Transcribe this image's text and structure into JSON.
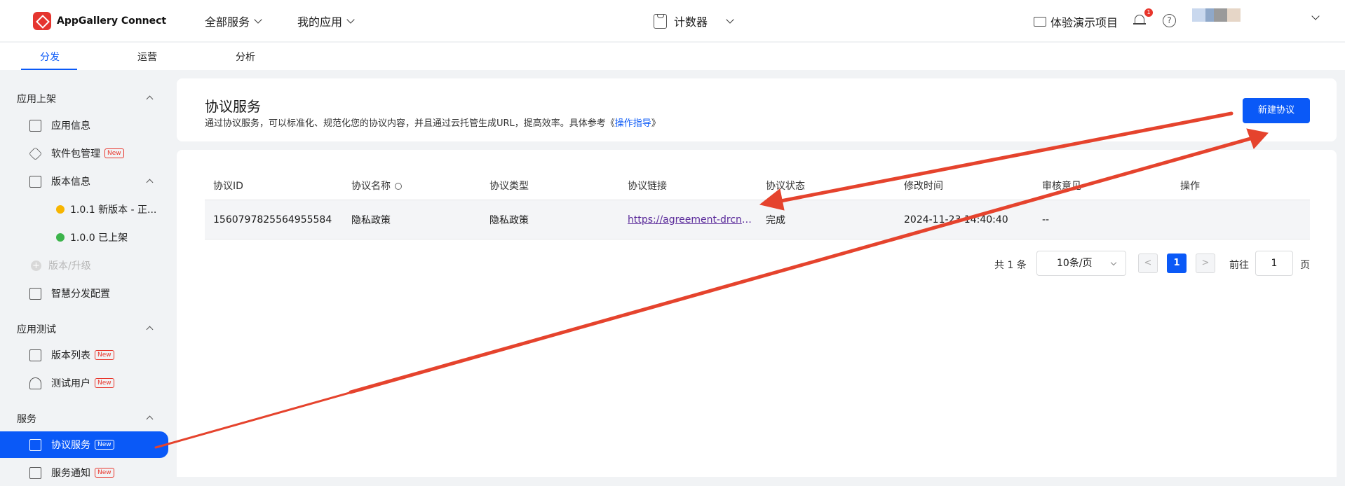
{
  "header": {
    "logo_text": "AppGallery Connect",
    "all_services": "全部服务",
    "my_apps": "我的应用",
    "current_app": "计数器",
    "demo_project": "体验演示项目",
    "notification_count": "1",
    "help": "?"
  },
  "tabs": [
    "分发",
    "运营",
    "分析"
  ],
  "sidebar": {
    "groups": [
      {
        "title": "应用上架"
      },
      {
        "title": "应用测试"
      },
      {
        "title": "服务"
      }
    ],
    "items": {
      "app_info": "应用信息",
      "package_mgmt": "软件包管理",
      "version_info": "版本信息",
      "version_101": "1.0.1 新版本 - 正...",
      "version_100": "1.0.0 已上架",
      "version_upgrade": "版本/升级",
      "smart_dist": "智慧分发配置",
      "version_list": "版本列表",
      "test_users": "测试用户",
      "agreement_service": "协议服务",
      "service_notice": "服务通知"
    },
    "new_tag": "New"
  },
  "main": {
    "title": "协议服务",
    "description": "通过协议服务，可以标准化、规范化您的协议内容，并且通过云托管生成URL，提高效率。具体参考《",
    "description_link": "操作指导",
    "description_end": "》",
    "new_button": "新建协议"
  },
  "table": {
    "columns": [
      "协议ID",
      "协议名称",
      "协议类型",
      "协议链接",
      "协议状态",
      "修改时间",
      "审核意见",
      "操作"
    ],
    "rows": [
      [
        "1560797825564955584",
        "隐私政策",
        "隐私政策",
        "https://agreement-drcn.cloud.huawei.com",
        "完成",
        "2024-11-23 14:40:40",
        "--",
        ""
      ]
    ]
  },
  "pagination": {
    "total": "共 1 条",
    "page_size": "10条/页",
    "prev": "<",
    "current": "1",
    "next": ">",
    "goto_label": "前往",
    "goto_value": "1",
    "page_unit": "页"
  },
  "colors": {
    "accent": "#0a59f7",
    "annotation_arrow": "#e5432d",
    "new_tag": "#e8352b"
  }
}
